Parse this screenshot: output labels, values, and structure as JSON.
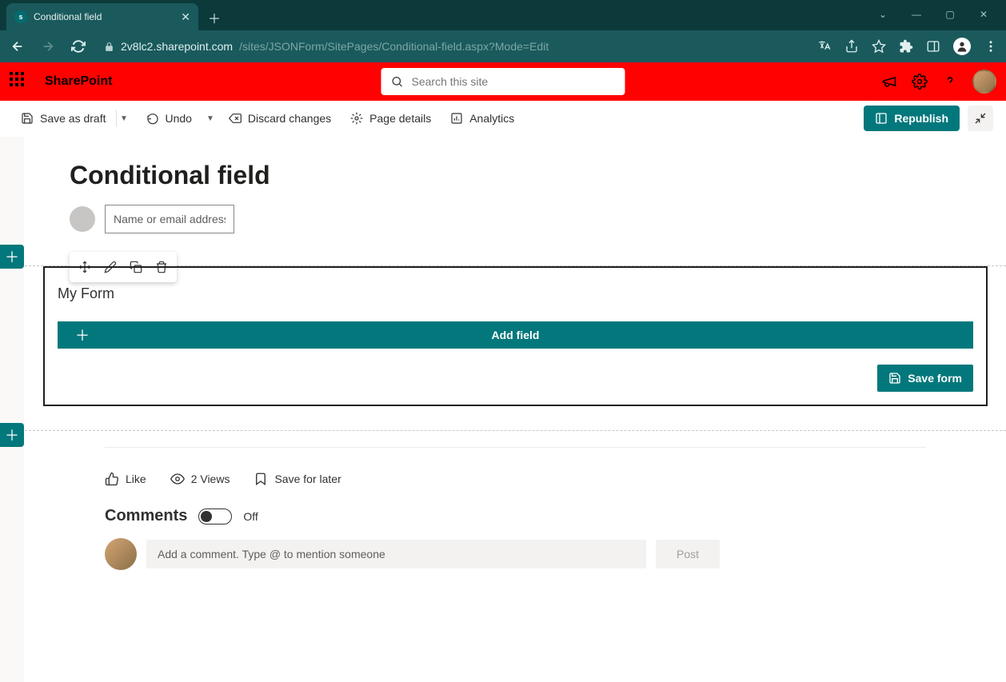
{
  "browser": {
    "tab_title": "Conditional field",
    "url_host": "2v8lc2.sharepoint.com",
    "url_path": "/sites/JSONForm/SitePages/Conditional-field.aspx?Mode=Edit"
  },
  "suite": {
    "app_name": "SharePoint",
    "search_placeholder": "Search this site"
  },
  "commands": {
    "save_draft": "Save as draft",
    "undo": "Undo",
    "discard": "Discard changes",
    "page_details": "Page details",
    "analytics": "Analytics",
    "republish": "Republish"
  },
  "page": {
    "title": "Conditional field",
    "author_placeholder": "Name or email address"
  },
  "form": {
    "title": "My Form",
    "add_field": "Add field",
    "save_form": "Save form"
  },
  "social": {
    "like": "Like",
    "views": "2 Views",
    "save_later": "Save for later",
    "comments_heading": "Comments",
    "comments_toggle": "Off",
    "comment_placeholder": "Add a comment. Type @ to mention someone",
    "post": "Post"
  }
}
